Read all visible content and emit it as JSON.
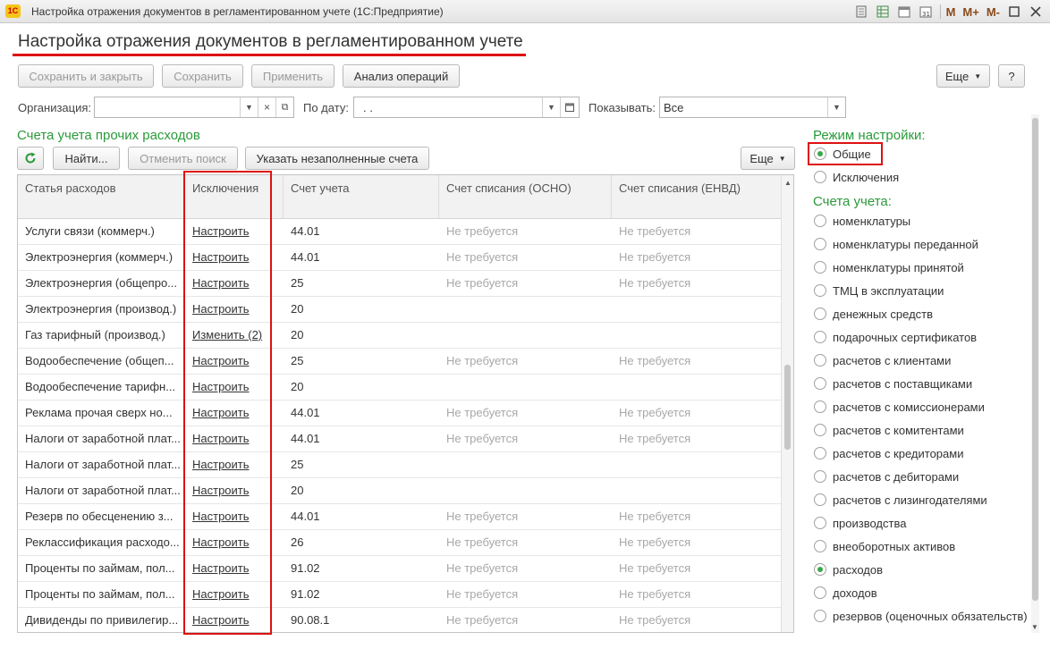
{
  "window": {
    "app_logo": "1С",
    "title": "Настройка отражения документов в регламентированном учете  (1С:Предприятие)",
    "icons": [
      "print-preview-icon",
      "table-icon",
      "calendar-icon",
      "calendar-31-icon"
    ],
    "memory_buttons": [
      "M",
      "M+",
      "M-"
    ]
  },
  "page_title": "Настройка отражения документов в регламентированном учете",
  "toolbar": {
    "save_close": "Сохранить и закрыть",
    "save": "Сохранить",
    "apply": "Применить",
    "analysis": "Анализ операций",
    "more": "Еще",
    "help": "?"
  },
  "filters": {
    "org_label": "Организация:",
    "org_value": "",
    "date_label": "По дату:",
    "date_value": " .  .",
    "show_label": "Показывать:",
    "show_value": "Все"
  },
  "section_title": "Счета учета прочих расходов",
  "list_toolbar": {
    "find": "Найти...",
    "cancel_search": "Отменить поиск",
    "fill_accounts": "Указать незаполненные счета",
    "more": "Еще"
  },
  "table": {
    "columns": [
      "Статья расходов",
      "Исключения",
      "Счет учета",
      "Счет списания (ОСНО)",
      "Счет списания (ЕНВД)"
    ],
    "rows": [
      {
        "item": "Услуги связи (коммерч.)",
        "exception": "Настроить",
        "account": "44.01",
        "osno": "Не требуется",
        "envd": "Не требуется"
      },
      {
        "item": "Электроэнергия (коммерч.)",
        "exception": "Настроить",
        "account": "44.01",
        "osno": "Не требуется",
        "envd": "Не требуется"
      },
      {
        "item": "Электроэнергия (общепро...",
        "exception": "Настроить",
        "account": "25",
        "osno": "Не требуется",
        "envd": "Не требуется"
      },
      {
        "item": "Электроэнергия (производ.)",
        "exception": "Настроить",
        "account": "20",
        "osno": "",
        "envd": ""
      },
      {
        "item": "Газ тарифный (производ.)",
        "exception": "Изменить (2)",
        "account": "20",
        "osno": "",
        "envd": ""
      },
      {
        "item": "Водообеспечение (общеп...",
        "exception": "Настроить",
        "account": "25",
        "osno": "Не требуется",
        "envd": "Не требуется"
      },
      {
        "item": "Водообеспечение тарифн...",
        "exception": "Настроить",
        "account": "20",
        "osno": "",
        "envd": ""
      },
      {
        "item": "Реклама прочая сверх но...",
        "exception": "Настроить",
        "account": "44.01",
        "osno": "Не требуется",
        "envd": "Не требуется"
      },
      {
        "item": "Налоги от заработной плат...",
        "exception": "Настроить",
        "account": "44.01",
        "osno": "Не требуется",
        "envd": "Не требуется"
      },
      {
        "item": "Налоги от заработной плат...",
        "exception": "Настроить",
        "account": "25",
        "osno": "",
        "envd": ""
      },
      {
        "item": "Налоги от заработной плат...",
        "exception": "Настроить",
        "account": "20",
        "osno": "",
        "envd": ""
      },
      {
        "item": "Резерв по обесценению з...",
        "exception": "Настроить",
        "account": "44.01",
        "osno": "Не требуется",
        "envd": "Не требуется"
      },
      {
        "item": "Реклассификация расходо...",
        "exception": "Настроить",
        "account": "26",
        "osno": "Не требуется",
        "envd": "Не требуется"
      },
      {
        "item": "Проценты по займам, пол...",
        "exception": "Настроить",
        "account": "91.02",
        "osno": "Не требуется",
        "envd": "Не требуется"
      },
      {
        "item": "Проценты по займам, пол...",
        "exception": "Настроить",
        "account": "91.02",
        "osno": "Не требуется",
        "envd": "Не требуется"
      },
      {
        "item": "Дивиденды по привилегир...",
        "exception": "Настроить",
        "account": "90.08.1",
        "osno": "Не требуется",
        "envd": "Не требуется"
      }
    ]
  },
  "settings_panel": {
    "mode_title": "Режим настройки:",
    "modes": [
      {
        "label": "Общие",
        "selected": true
      },
      {
        "label": "Исключения",
        "selected": false
      }
    ],
    "accounts_title": "Счета учета:",
    "accounts": [
      {
        "label": "номенклатуры",
        "selected": false
      },
      {
        "label": "номенклатуры переданной",
        "selected": false
      },
      {
        "label": "номенклатуры принятой",
        "selected": false
      },
      {
        "label": "ТМЦ в эксплуатации",
        "selected": false
      },
      {
        "label": "денежных средств",
        "selected": false
      },
      {
        "label": "подарочных сертификатов",
        "selected": false
      },
      {
        "label": "расчетов с клиентами",
        "selected": false
      },
      {
        "label": "расчетов с поставщиками",
        "selected": false
      },
      {
        "label": "расчетов с комиссионерами",
        "selected": false
      },
      {
        "label": "расчетов с комитентами",
        "selected": false
      },
      {
        "label": "расчетов с кредиторами",
        "selected": false
      },
      {
        "label": "расчетов с дебиторами",
        "selected": false
      },
      {
        "label": "расчетов с лизингодателями",
        "selected": false
      },
      {
        "label": "производства",
        "selected": false
      },
      {
        "label": "внеоборотных активов",
        "selected": false
      },
      {
        "label": "расходов",
        "selected": true
      },
      {
        "label": "доходов",
        "selected": false
      },
      {
        "label": "резервов (оценочных обязательств)",
        "selected": false
      }
    ]
  },
  "colors": {
    "accent_green": "#2a9a3a",
    "highlight_red": "#dd1111"
  }
}
